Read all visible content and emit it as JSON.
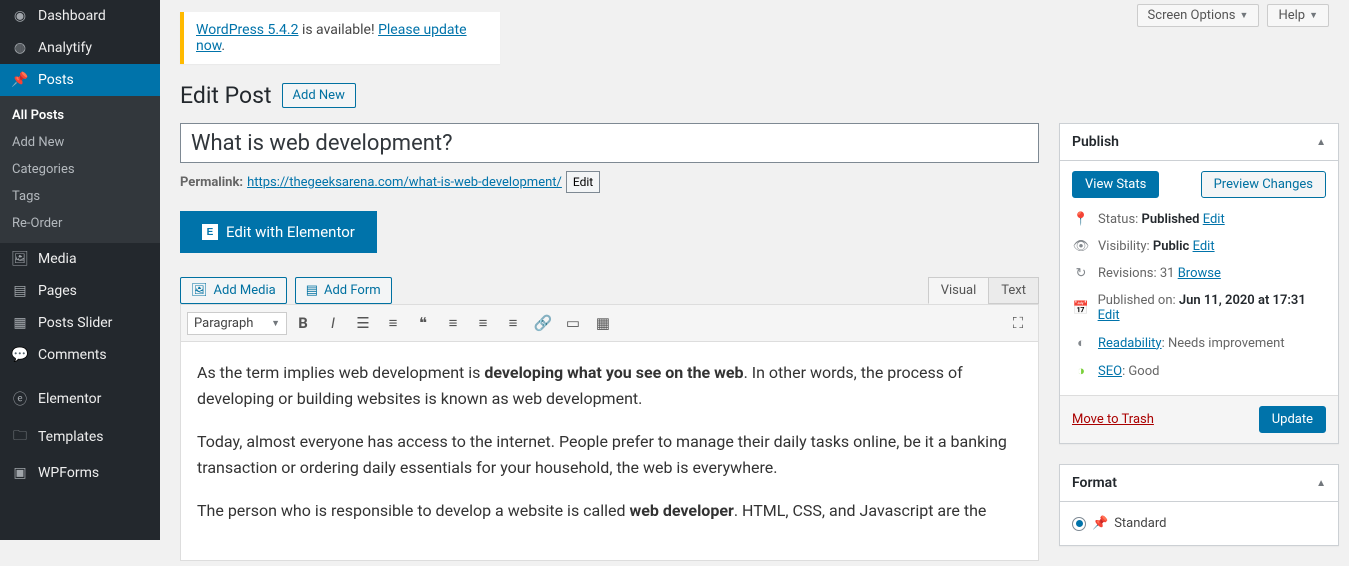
{
  "topbar": {
    "screen_options": "Screen Options",
    "help": "Help"
  },
  "sidebar": {
    "items": [
      {
        "label": "Dashboard"
      },
      {
        "label": "Analytify"
      },
      {
        "label": "Posts"
      },
      {
        "label": "Media"
      },
      {
        "label": "Pages"
      },
      {
        "label": "Posts Slider"
      },
      {
        "label": "Comments"
      },
      {
        "label": "Elementor"
      },
      {
        "label": "Templates"
      },
      {
        "label": "WPForms"
      }
    ],
    "submenu": [
      "All Posts",
      "Add New",
      "Categories",
      "Tags",
      "Re-Order"
    ]
  },
  "notice": {
    "link1": "WordPress 5.4.2",
    "mid": " is available! ",
    "link2": "Please update now",
    "end": "."
  },
  "page": {
    "title": "Edit Post",
    "add_new": "Add New"
  },
  "post": {
    "title": "What is web development?",
    "permalink_label": "Permalink:",
    "permalink_url": "https://thegeeksarena.com/what-is-web-development/",
    "edit": "Edit",
    "elementor": "Edit with Elementor",
    "add_media": "Add Media",
    "add_form": "Add Form",
    "tab_visual": "Visual",
    "tab_text": "Text",
    "para": "Paragraph",
    "p1a": "As the term implies web development is ",
    "p1b": "developing what you see on the web",
    "p1c": ". In other words, the process of developing or building websites is known as web development.",
    "p2": "Today, almost everyone has access to the internet. People prefer to manage their daily tasks online, be it a banking transaction or ordering daily essentials for your household, the web is everywhere.",
    "p3a": "The person who is responsible to develop a website is called ",
    "p3b": "web developer",
    "p3c": ". HTML, CSS, and Javascript are the"
  },
  "publish": {
    "title": "Publish",
    "view_stats": "View Stats",
    "preview": "Preview Changes",
    "status_label": "Status: ",
    "status_val": "Published",
    "visibility_label": "Visibility: ",
    "visibility_val": "Public",
    "revisions_label": "Revisions: ",
    "revisions_val": "31",
    "browse": "Browse",
    "published_label": "Published on: ",
    "published_val": "Jun 11, 2020 at 17:31",
    "edit": "Edit",
    "readability": "Readability",
    "readability_val": ": Needs improvement",
    "seo": "SEO",
    "seo_val": ": Good",
    "trash": "Move to Trash",
    "update": "Update"
  },
  "format": {
    "title": "Format",
    "standard": "Standard"
  }
}
